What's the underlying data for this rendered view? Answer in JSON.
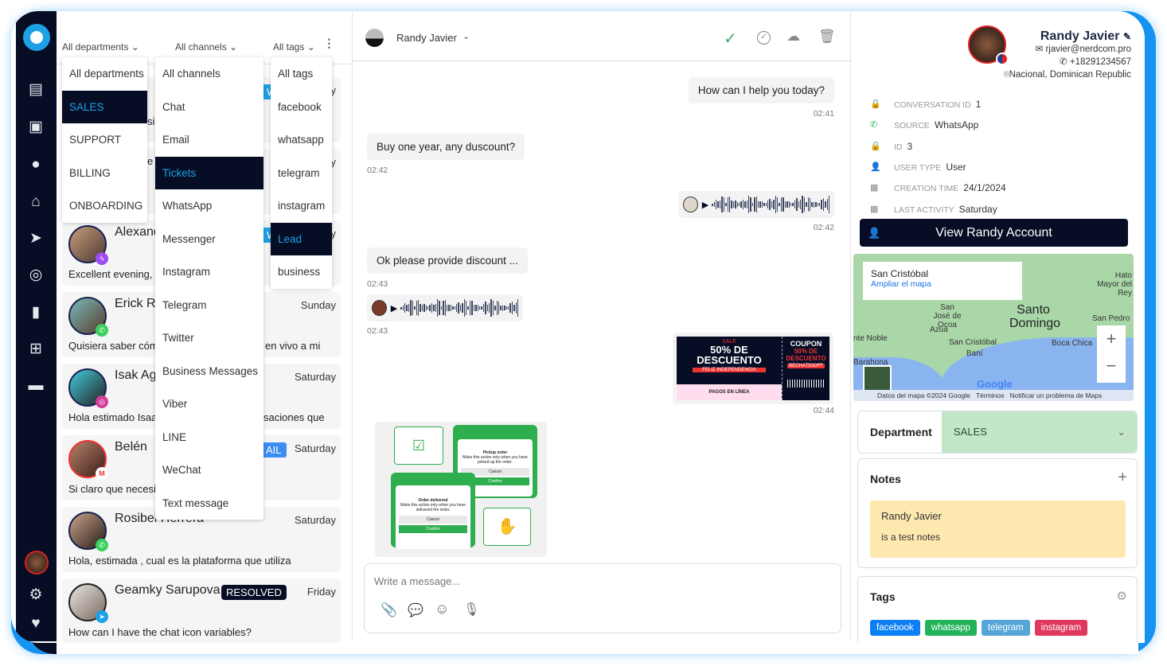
{
  "filters": {
    "departments": "All departments",
    "channels": "All channels",
    "tags": "All tags"
  },
  "dropdowns": {
    "departments": [
      "All departments",
      "SALES",
      "SUPPORT",
      "BILLING",
      "ONBOARDING"
    ],
    "departments_selected": "SALES",
    "channels": [
      "All channels",
      "Chat",
      "Email",
      "Tickets",
      "WhatsApp",
      "Messenger",
      "Instagram",
      "Telegram",
      "Twitter",
      "Business Messages",
      "Viber",
      "LINE",
      "WeChat",
      "Text message"
    ],
    "channels_selected": "Tickets",
    "tags": [
      "All tags",
      "facebook",
      "whatsapp",
      "telegram",
      "instagram",
      "Lead",
      "business"
    ],
    "tags_selected": "Lead"
  },
  "conversations": [
    {
      "name": "J",
      "badge": "W",
      "date": "y",
      "preview": "si"
    },
    {
      "name": "",
      "badge": "",
      "date": "y",
      "preview": "e"
    },
    {
      "name": "Alexand",
      "badge": "W",
      "date": "y",
      "preview": "Excellent evening, c",
      "channel": "messenger"
    },
    {
      "name": "Erick Ri",
      "date": "Sunday",
      "preview": "Quisiera saber cóm",
      "preview_end": "en vivo a mi",
      "channel": "whatsapp"
    },
    {
      "name": "Isak Agu",
      "date": "Saturday",
      "preview": "Hola estimado Isaal",
      "preview_end": "saciones que",
      "channel": "instagram"
    },
    {
      "name": "Belén",
      "badge": "AIL",
      "date": "Saturday",
      "preview": "Si claro que necesita",
      "channel": "gmail"
    },
    {
      "name": "Rosibel Herrera",
      "date": "Saturday",
      "preview": "Hola, estimada , cual es la plataforma que utiliza",
      "channel": "whatsapp"
    },
    {
      "name": "Geamky Sarupova",
      "badge": "RESOLVED",
      "date": "Friday",
      "preview": "How can I have the chat icon variables?",
      "channel": "telegram"
    }
  ],
  "chat": {
    "contact": "Randy Javier",
    "messages": [
      {
        "text": "How can I help you today?",
        "time": "02:41",
        "side": "right"
      },
      {
        "text": "Buy one year, any duscount?",
        "time": "02:42",
        "side": "left"
      },
      {
        "type": "audio",
        "time": "02:42",
        "side": "right"
      },
      {
        "text": "Ok please provide discount ...",
        "time": "02:43",
        "side": "left"
      },
      {
        "type": "audio",
        "time": "02:43",
        "side": "left"
      },
      {
        "type": "image",
        "time": "02:44",
        "side": "right",
        "sale": "SALE",
        "headline": "50% DE DESCUENTO",
        "banner": "FELIZ INDEPENDENCIA",
        "footer": "PAGOS EN LÍNEA",
        "coupon": "COUPON",
        "coupon_discount": "50% DE DESCUENTO",
        "code": "BECHAT50OFF"
      },
      {
        "type": "image",
        "side": "left",
        "card1_title": "Pickup order",
        "card1_text": "Make this action only when you have picked up the order.",
        "card2_title": "Order delivered",
        "card2_text": "Make this action only when you have delivered the order.",
        "cancel": "Cancel",
        "confirm": "Confirm"
      }
    ],
    "composer_placeholder": "Write a message..."
  },
  "profile": {
    "name": "Randy Javier",
    "email": "rjavier@nerdcom.pro",
    "phone": "+18291234567",
    "location": "Nacional, Dominican Republic",
    "fields": [
      {
        "label": "CONVERSATION ID",
        "value": "1",
        "icon": "lock-icon"
      },
      {
        "label": "SOURCE",
        "value": "WhatsApp",
        "icon": "whatsapp-icon"
      },
      {
        "label": "ID",
        "value": "3",
        "icon": "lock-icon"
      },
      {
        "label": "USER TYPE",
        "value": "User",
        "icon": "user-icon"
      },
      {
        "label": "CREATION TIME",
        "value": "24/1/2024",
        "icon": "calendar-icon"
      },
      {
        "label": "LAST ACTIVITY",
        "value": "Saturday",
        "icon": "calendar-icon"
      }
    ],
    "view_account": "View Randy Account"
  },
  "map": {
    "place": "San Cristóbal",
    "enlarge": "Ampliar el mapa",
    "labels": [
      "Santo Domingo",
      "San José de Ocoa",
      "Azua",
      "San Cristóbal",
      "Baní",
      "Boca Chica",
      "Hato Mayor del Rey",
      "San Pedro",
      "Barahona",
      "nte Noble"
    ],
    "attribution": "Datos del mapa ©2024 Google",
    "terms": "Términos",
    "report": "Notificar un problema de Maps",
    "logo": "Google"
  },
  "department": {
    "label": "Department",
    "value": "SALES"
  },
  "notes": {
    "title": "Notes",
    "author": "Randy Javier",
    "text": "is a test notes"
  },
  "tags": {
    "title": "Tags",
    "items": [
      {
        "label": "facebook",
        "color": "#0d7ff5"
      },
      {
        "label": "whatsapp",
        "color": "#21b35a"
      },
      {
        "label": "telegram",
        "color": "#55a5d8"
      },
      {
        "label": "instagram",
        "color": "#e0385f"
      }
    ]
  }
}
